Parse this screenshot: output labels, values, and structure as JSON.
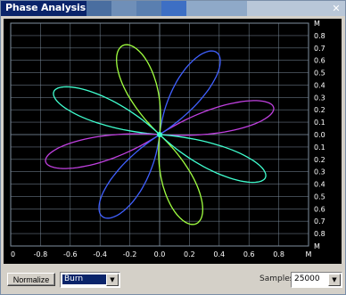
{
  "window": {
    "title": "Phase Analysis",
    "close_glyph": "✕",
    "titlebar_colors": [
      "#0a246a",
      "#4a6ea0",
      "#6f8fb8",
      "#5a7fb0",
      "#3d6fc4",
      "#8fa9c8",
      "#b9c7d8"
    ]
  },
  "plot": {
    "background": "#000000",
    "grid_color": "#7f8fa0",
    "right_axis_labels": [
      "M",
      "0.8",
      "0.7",
      "0.6",
      "0.5",
      "0.4",
      "0.3",
      "0.2",
      "0.1",
      "0.0",
      "0.1",
      "0.2",
      "0.3",
      "0.4",
      "0.5",
      "0.6",
      "0.7",
      "0.8",
      "M"
    ],
    "bottom_axis_labels": [
      "0",
      "-0.8",
      "-0.6",
      "-0.4",
      "-0.2",
      "0.0",
      "0.2",
      "0.4",
      "0.6",
      "0.8",
      "M"
    ],
    "curve": {
      "type": "rose",
      "petals": 8,
      "amplitude": 0.8,
      "colors": [
        "#c040e0",
        "#4060ff",
        "#a0ff40",
        "#40ffd0"
      ]
    }
  },
  "controls": {
    "normalize_label": "Normalize",
    "mode_value": "Burn",
    "samples_label": "Samples",
    "samples_value": "25000",
    "dropdown_glyph": "▼"
  }
}
